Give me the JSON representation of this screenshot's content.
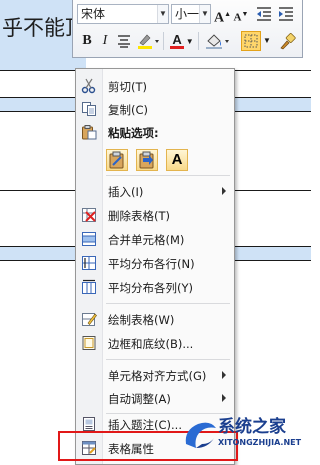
{
  "document": {
    "cell_text": "乎不能顶"
  },
  "mini_toolbar": {
    "font_name": "宋体",
    "font_size": "小一",
    "grow_font": "A",
    "shrink_font": "A",
    "bold": "B",
    "italic": "I",
    "text_color_letter": "A"
  },
  "context_menu": {
    "items": [
      {
        "label": "剪切(T)",
        "icon": "scissors-icon"
      },
      {
        "label": "复制(C)",
        "icon": "copy-icon"
      },
      {
        "label": "粘贴选项:",
        "icon": "paste-icon"
      },
      {
        "label": "插入(I)",
        "icon": "none",
        "submenu": true
      },
      {
        "label": "删除表格(T)",
        "icon": "delete-table-icon"
      },
      {
        "label": "合并单元格(M)",
        "icon": "merge-cells-icon"
      },
      {
        "label": "平均分布各行(N)",
        "icon": "distribute-rows-icon"
      },
      {
        "label": "平均分布各列(Y)",
        "icon": "distribute-columns-icon"
      },
      {
        "label": "绘制表格(W)",
        "icon": "draw-table-icon"
      },
      {
        "label": "边框和底纹(B)...",
        "icon": "borders-icon"
      },
      {
        "label": "单元格对齐方式(G)",
        "icon": "none",
        "submenu": true
      },
      {
        "label": "自动调整(A)",
        "icon": "none",
        "submenu": true
      },
      {
        "label": "插入题注(C)...",
        "icon": "caption-icon"
      },
      {
        "label": "表格属性",
        "icon": "table-properties-icon"
      }
    ],
    "paste_options": [
      "keep-format",
      "merge-format",
      "text-only"
    ],
    "paste_text_letter": "A"
  },
  "watermark": {
    "title": "系统之家",
    "url": "XITONGZHIJIA.NET"
  },
  "colors": {
    "selection": "#cfe2f6",
    "highlight": "#e11818",
    "watermark": "#1b3f8f"
  }
}
